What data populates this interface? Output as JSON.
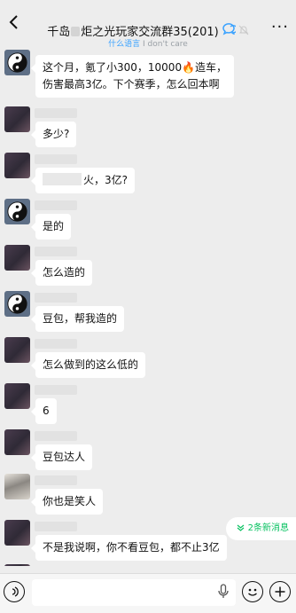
{
  "header": {
    "title_prefix": "千岛",
    "title_suffix": "炬之光玩家交流群35(201)",
    "subtitle_prefix": "什么语言",
    "subtitle_suffix": " I don't care",
    "more_label": "···"
  },
  "messages": [
    {
      "text_pre": "这个月，氪了小300，10000",
      "text_mid": "🔥",
      "text_post": "造车，",
      "line2": "伤害最高3亿。下个赛季，怎么回本啊",
      "avatar": "taiji"
    },
    {
      "text": "多少?",
      "avatar": "dark"
    },
    {
      "text": "火，3亿?",
      "avatar": "dark"
    },
    {
      "text": "是的",
      "avatar": "taiji"
    },
    {
      "text": "怎么造的",
      "avatar": "dark"
    },
    {
      "text": "豆包，帮我造的",
      "avatar": "taiji"
    },
    {
      "text": "怎么做到的这么低的",
      "avatar": "dark"
    },
    {
      "text": "6",
      "avatar": "dark"
    },
    {
      "text": "豆包达人",
      "avatar": "dark"
    },
    {
      "text": "你也是笑人",
      "avatar": "photo"
    },
    {
      "text": "不是我说啊，你不看豆包，都不止3亿",
      "avatar": "dark"
    }
  ],
  "new_messages_label": "2条新消息",
  "colors": {
    "background": "#ededed",
    "bubble": "#ffffff",
    "accent_green": "#07c160",
    "link_blue": "#3aa2ff"
  },
  "icons": {
    "back": "chevron-left-icon",
    "chat": "chat-bubble-icon",
    "mute": "bell-off-icon",
    "voice": "voice-icon",
    "mic": "mic-icon",
    "emoji": "emoji-icon",
    "plus": "plus-icon"
  }
}
